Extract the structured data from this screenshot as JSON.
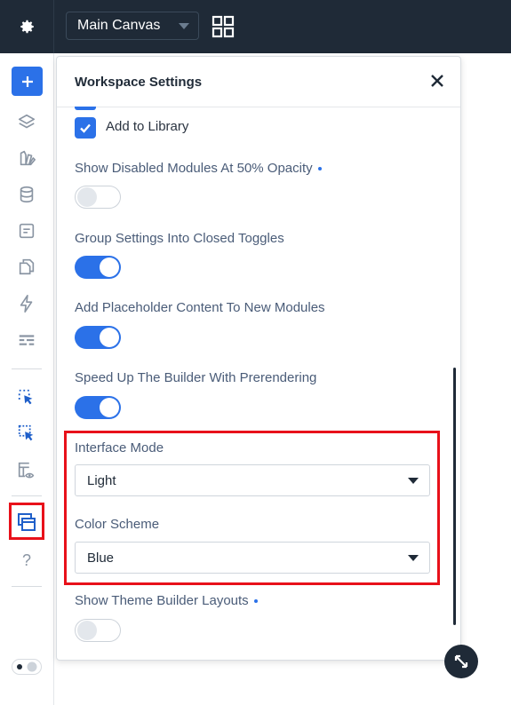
{
  "topbar": {
    "settings_icon": "gear-icon",
    "canvas_select": {
      "value": "Main Canvas"
    },
    "layout_icon": "grid-icon"
  },
  "sidebar": {
    "items": [
      {
        "name": "add-module",
        "icon": "plus-icon"
      },
      {
        "name": "layers",
        "icon": "layers-icon"
      },
      {
        "name": "design-library",
        "icon": "palette-icon"
      },
      {
        "name": "database",
        "icon": "database-icon"
      },
      {
        "name": "page-settings",
        "icon": "form-icon"
      },
      {
        "name": "pages",
        "icon": "copy-icon"
      },
      {
        "name": "quick-actions",
        "icon": "lightning-icon"
      },
      {
        "name": "presets",
        "icon": "rows-icon"
      },
      {
        "name": "click-mode",
        "icon": "pointer-select-icon"
      },
      {
        "name": "hover-mode",
        "icon": "pointer-select-alt-icon"
      },
      {
        "name": "preview",
        "icon": "layout-eye-icon"
      },
      {
        "name": "workspace",
        "icon": "windows-icon"
      },
      {
        "name": "help",
        "icon": "question-icon"
      },
      {
        "name": "theme-toggle",
        "icon": "theme-toggle-icon"
      }
    ],
    "help_label": "?"
  },
  "panel": {
    "title": "Workspace Settings",
    "add_to_library": {
      "label": "Add to Library",
      "checked": true
    },
    "settings": [
      {
        "label": "Show Disabled Modules At 50% Opacity",
        "state": "off",
        "has_dot": true
      },
      {
        "label": "Group Settings Into Closed Toggles",
        "state": "on",
        "has_dot": false
      },
      {
        "label": "Add Placeholder Content To New Modules",
        "state": "on",
        "has_dot": false
      },
      {
        "label": "Speed Up The Builder With Prerendering",
        "state": "on",
        "has_dot": false
      }
    ],
    "interface_mode": {
      "label": "Interface Mode",
      "value": "Light"
    },
    "color_scheme": {
      "label": "Color Scheme",
      "value": "Blue"
    },
    "theme_builder": {
      "label": "Show Theme Builder Layouts",
      "state": "off",
      "has_dot": true
    }
  },
  "colors": {
    "accent": "#2b71e8",
    "dark": "#1f2a37",
    "highlight": "#e8111a"
  }
}
